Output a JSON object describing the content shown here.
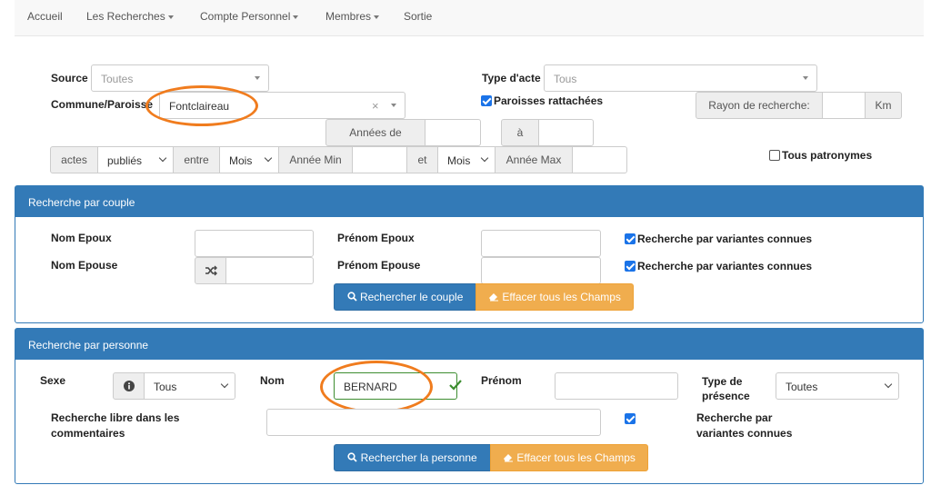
{
  "nav": {
    "items": [
      {
        "label": "Accueil",
        "dropdown": false
      },
      {
        "label": "Les Recherches",
        "dropdown": true
      },
      {
        "label": "Compte Personnel",
        "dropdown": true
      },
      {
        "label": "Membres",
        "dropdown": true
      },
      {
        "label": "Sortie",
        "dropdown": false
      }
    ]
  },
  "filters": {
    "source_label": "Source",
    "source_placeholder": "Toutes",
    "type_acte_label": "Type d'acte",
    "type_acte_placeholder": "Tous",
    "commune_label": "Commune/Paroisse",
    "commune_value": "Fontclaireau",
    "commune_clear": "×",
    "paroisses_label": "Paroisses rattachées",
    "paroisses_checked": true,
    "rayon_label": "Rayon de recherche:",
    "rayon_unit": "Km",
    "annees_label": "Années de",
    "a_label": "à",
    "actes_label": "actes",
    "publies_value": "publiés",
    "entre_label": "entre",
    "mois_value_1": "Mois",
    "annee_min_label": "Année Min",
    "et_label": "et",
    "mois_value_2": "Mois",
    "annee_max_label": "Année Max",
    "tous_patronymes_label": "Tous patronymes",
    "tous_patronymes_checked": false
  },
  "couple": {
    "title": "Recherche par couple",
    "nom_epoux_label": "Nom Epoux",
    "prenom_epoux_label": "Prénom Epoux",
    "variantes_label_1": "Recherche par variantes connues",
    "nom_epouse_label": "Nom Epouse",
    "prenom_epouse_label": "Prénom Epouse",
    "variantes_label_2": "Recherche par variantes connues",
    "search_button": "Rechercher le couple",
    "clear_button": "Effacer tous les Champs"
  },
  "personne": {
    "title": "Recherche par personne",
    "sexe_label": "Sexe",
    "sexe_value": "Tous",
    "nom_label": "Nom",
    "nom_value": "BERNARD",
    "prenom_label": "Prénom",
    "type_presence_label_1": "Type de",
    "type_presence_label_2": "présence",
    "type_presence_value": "Toutes",
    "libre_label_1": "Recherche libre dans les",
    "libre_label_2": "commentaires",
    "variantes_label_1": "Recherche par",
    "variantes_label_2": "variantes connues",
    "search_button": "Rechercher la personne",
    "clear_button": "Effacer tous les Champs"
  },
  "colors": {
    "primary": "#337ab7",
    "warning": "#f0ad4e",
    "highlight": "#f07c1e",
    "valid": "#3c8d2f"
  }
}
